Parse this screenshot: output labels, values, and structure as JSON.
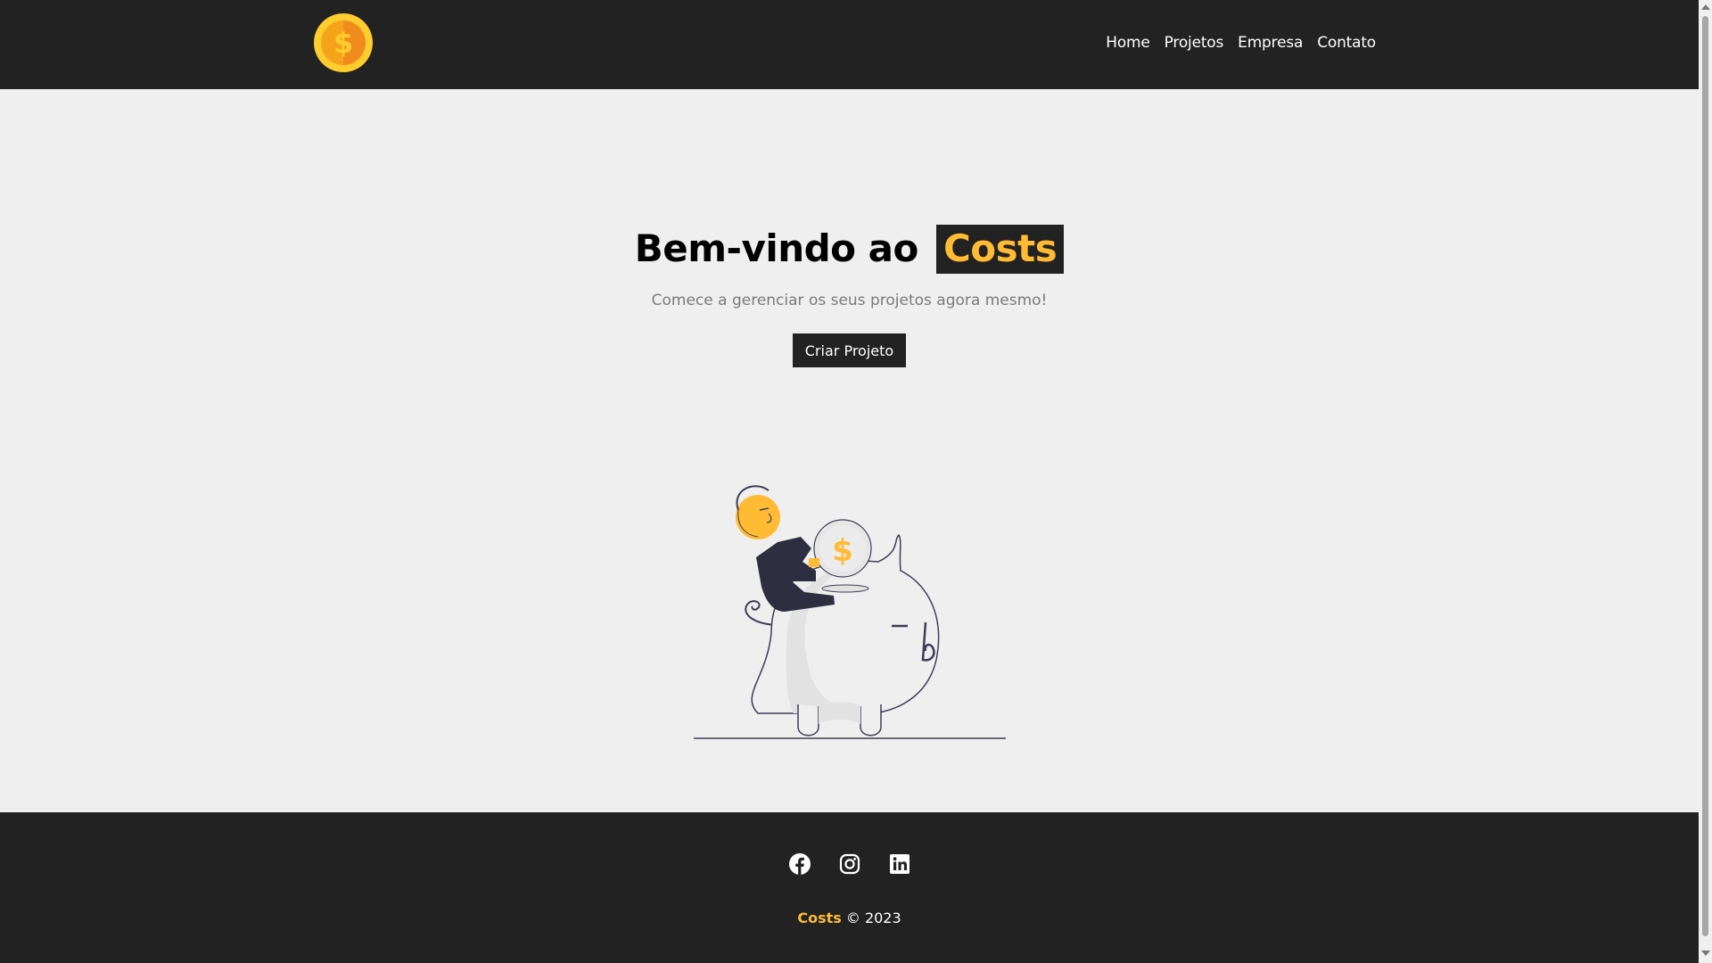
{
  "navbar": {
    "logo_icon": "dollar-coin-icon",
    "links": [
      {
        "label": "Home"
      },
      {
        "label": "Projetos"
      },
      {
        "label": "Empresa"
      },
      {
        "label": "Contato"
      }
    ]
  },
  "hero": {
    "title_prefix": "Bem-vindo ao",
    "title_brand": "Costs",
    "subtitle": "Comece a gerenciar os seus projetos agora mesmo!",
    "cta_label": "Criar Projeto",
    "illustration": "piggy-bank-savings-illustration"
  },
  "footer": {
    "social": [
      "facebook-icon",
      "instagram-icon",
      "linkedin-icon"
    ],
    "brand": "Costs",
    "copyright": "© 2023"
  },
  "colors": {
    "dark": "#222222",
    "accent": "#ffbb33",
    "background": "#efefef",
    "muted_text": "#7b7b7b"
  }
}
